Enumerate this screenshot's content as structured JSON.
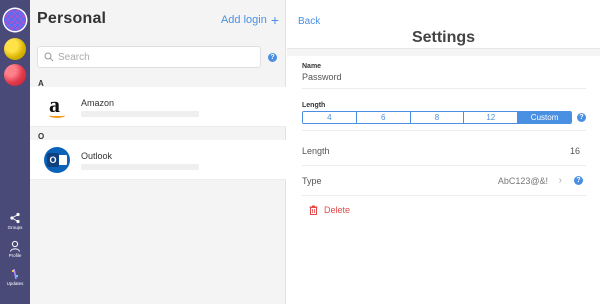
{
  "rail": {
    "vaults": [
      "vault-checker",
      "vault-yellow",
      "vault-red"
    ],
    "groups_label": "Groups",
    "profile_label": "Profile",
    "updates_label": "Updates"
  },
  "list": {
    "title": "Personal",
    "add_login_label": "Add login",
    "add_icon": "+",
    "search_placeholder": "Search",
    "help": "?",
    "sections": [
      {
        "letter": "A",
        "entries": [
          {
            "name": "Amazon",
            "logo": "a"
          }
        ]
      },
      {
        "letter": "O",
        "entries": [
          {
            "name": "Outlook",
            "logo": "O"
          }
        ]
      }
    ]
  },
  "settings": {
    "back_label": "Back",
    "title": "Settings",
    "name_label": "Name",
    "name_value": "Password",
    "length_label": "Length",
    "length_options": [
      "4",
      "6",
      "8",
      "12",
      "Custom"
    ],
    "length_selected": "Custom",
    "length_row_label": "Length",
    "length_row_value": "16",
    "type_row_label": "Type",
    "type_row_value": "AbC123@&!",
    "chevron": "›",
    "help": "?",
    "delete_label": "Delete"
  },
  "colors": {
    "accent": "#4a90e2",
    "rail": "#4a4a79",
    "danger": "#e24a4a"
  }
}
